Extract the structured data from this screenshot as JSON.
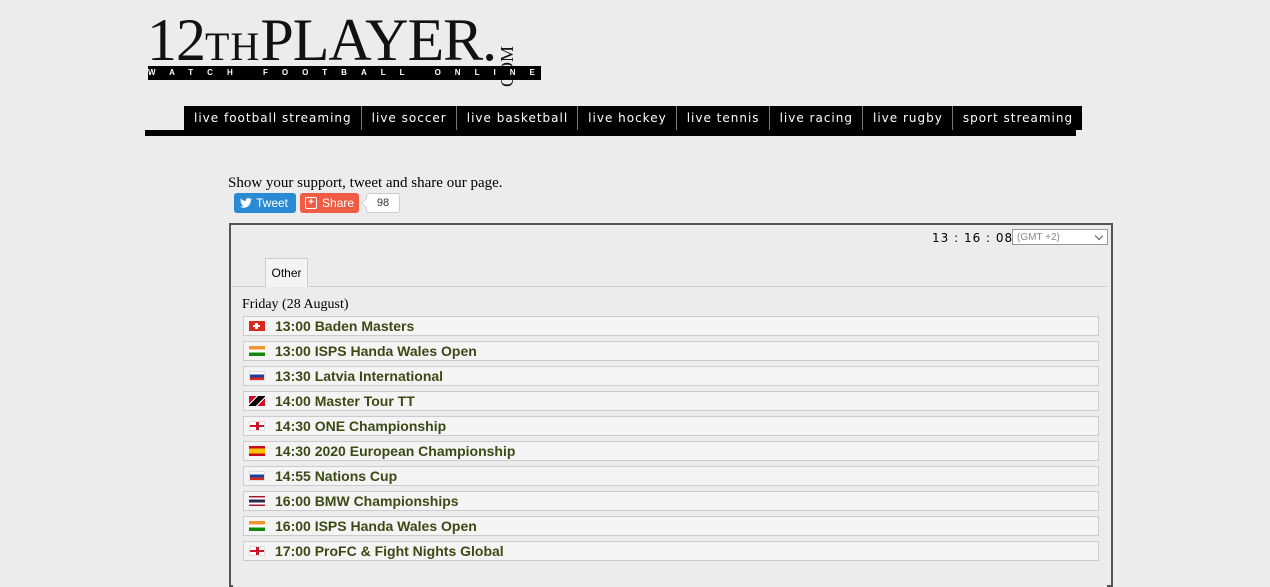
{
  "logo": {
    "main": "12",
    "th": "TH",
    "player": "PLAYER.",
    "com": "COM",
    "tagline": "WATCH FOOTBALL ONLINE"
  },
  "nav": [
    "live football streaming",
    "live soccer",
    "live basketball",
    "live hockey",
    "live tennis",
    "live racing",
    "live rugby",
    "sport streaming"
  ],
  "support": {
    "text": "Show your support, tweet and share our page.",
    "tweet_label": "Tweet",
    "share_label": "Share",
    "share_count": "98"
  },
  "schedule": {
    "clock": "13 : 16 : 08",
    "timezone": "(GMT +2)",
    "tab": "Other",
    "day": "Friday (28 August)",
    "events": [
      {
        "flag": "switzerland-flag-icon",
        "text": "13:00 Baden Masters"
      },
      {
        "flag": "india-flag-icon",
        "text": "13:00 ISPS Handa Wales Open"
      },
      {
        "flag": "russia-flag-icon",
        "text": "13:30 Latvia International"
      },
      {
        "flag": "trinidad-flag-icon",
        "text": "14:00 Master Tour TT"
      },
      {
        "flag": "england-flag-icon",
        "text": "14:30 ONE Championship"
      },
      {
        "flag": "spain-flag-icon",
        "text": "14:30 2020 European Championship"
      },
      {
        "flag": "russia-flag-icon",
        "text": "14:55 Nations Cup"
      },
      {
        "flag": "thailand-flag-icon",
        "text": "16:00 BMW Championships"
      },
      {
        "flag": "india-flag-icon",
        "text": "16:00 ISPS Handa Wales Open"
      },
      {
        "flag": "england-flag-icon",
        "text": "17:00 ProFC & Fight Nights Global"
      }
    ]
  },
  "colors": {
    "background": "#ececec",
    "event_text": "#3b4a14",
    "tweet": "#2a8bd4",
    "share": "#f15c44"
  }
}
